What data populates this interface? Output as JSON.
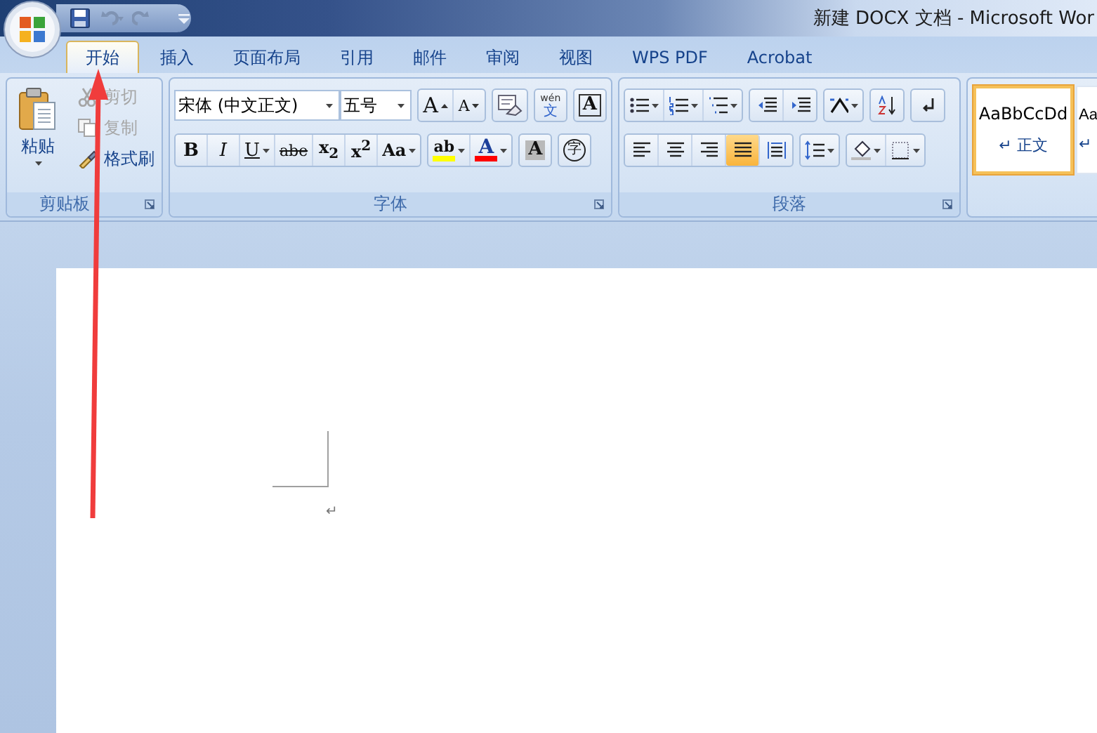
{
  "window": {
    "title": "新建 DOCX 文档 - Microsoft Wor"
  },
  "quick_access": [
    {
      "kind": "save",
      "disabled": false
    },
    {
      "kind": "undo",
      "disabled": true
    },
    {
      "kind": "redo",
      "disabled": true
    },
    {
      "kind": "customize",
      "disabled": false
    }
  ],
  "tabs": [
    {
      "label": "开始",
      "selected": true
    },
    {
      "label": "插入",
      "selected": false
    },
    {
      "label": "页面布局",
      "selected": false
    },
    {
      "label": "引用",
      "selected": false
    },
    {
      "label": "邮件",
      "selected": false
    },
    {
      "label": "审阅",
      "selected": false
    },
    {
      "label": "视图",
      "selected": false
    },
    {
      "label": "WPS PDF",
      "selected": false
    },
    {
      "label": "Acrobat",
      "selected": false
    }
  ],
  "clipboard": {
    "title": "剪贴板",
    "paste": "粘贴",
    "items": [
      {
        "kind": "cut",
        "label": "剪切",
        "disabled": true
      },
      {
        "kind": "copy",
        "label": "复制",
        "disabled": true
      },
      {
        "kind": "brush",
        "label": "格式刷",
        "disabled": false
      }
    ]
  },
  "font": {
    "title": "字体",
    "font_name": "宋体 (中文正文)",
    "font_size": "五号",
    "row1": [
      [
        {
          "kind": "grow",
          "label": "A"
        },
        {
          "kind": "shrink",
          "label": "A"
        }
      ],
      [
        {
          "kind": "clear"
        }
      ],
      [
        {
          "kind": "phonetic",
          "label": "wén",
          "label2": "文"
        }
      ],
      [
        {
          "kind": "boxed",
          "label": "A"
        }
      ]
    ],
    "row2": [
      [
        {
          "kind": "bold",
          "label": "B"
        },
        {
          "kind": "italic",
          "label": "I"
        },
        {
          "kind": "underline",
          "label": "U",
          "dropdown": true
        },
        {
          "kind": "strike",
          "label": "abe"
        },
        {
          "kind": "script",
          "label": "x$_{2}$"
        },
        {
          "kind": "script",
          "label": "x$^{2}$"
        },
        {
          "kind": "case",
          "label": "Aa",
          "dropdown": true
        }
      ],
      [
        {
          "kind": "highlight",
          "label": "ab",
          "dropdown": true,
          "color": "#ffff00"
        },
        {
          "kind": "fontcolor",
          "label": "A",
          "dropdown": true,
          "color": "#ff0000"
        }
      ],
      [
        {
          "kind": "shade",
          "label": "A"
        }
      ],
      [
        {
          "kind": "enclose",
          "label": "字"
        }
      ]
    ]
  },
  "paragraph": {
    "title": "段落",
    "row1": [
      [
        {
          "kind": "bullets",
          "dropdown": true
        },
        {
          "kind": "numbering",
          "dropdown": true
        },
        {
          "kind": "multilevel",
          "dropdown": true
        }
      ],
      [
        {
          "kind": "outdent"
        },
        {
          "kind": "indent"
        }
      ],
      [
        {
          "kind": "cjk",
          "dropdown": true
        }
      ],
      [
        {
          "kind": "sort"
        }
      ],
      [
        {
          "kind": "marks"
        }
      ]
    ],
    "alignments": [
      {
        "kind": "left",
        "selected": false
      },
      {
        "kind": "center",
        "selected": false
      },
      {
        "kind": "right",
        "selected": false
      },
      {
        "kind": "justify",
        "selected": true
      },
      {
        "kind": "distributed",
        "selected": false
      }
    ],
    "row2": [
      [
        {
          "kind": "spacing",
          "dropdown": true
        }
      ],
      [
        {
          "kind": "fill",
          "dropdown": true
        },
        {
          "kind": "borders",
          "dropdown": true
        }
      ]
    ]
  },
  "styles": [
    {
      "sample": "AaBbCcDd",
      "mark": "↵",
      "name": "正文",
      "selected": true
    },
    {
      "sample": "Aa",
      "mark": "↵",
      "selected": false
    }
  ],
  "document": {
    "paragraph_mark": "↵"
  }
}
